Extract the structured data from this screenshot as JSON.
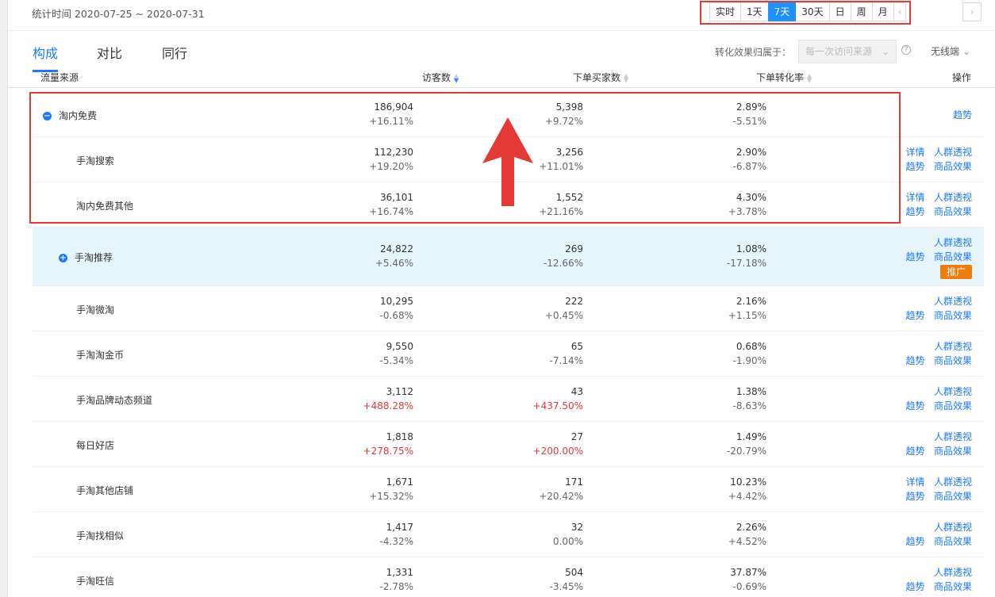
{
  "stat_time": "统计时间 2020-07-25 ~ 2020-07-31",
  "ranges": [
    "实时",
    "1天",
    "7天",
    "30天",
    "日",
    "周",
    "月"
  ],
  "prev_icon": "‹",
  "next_icon": "›",
  "tabs": [
    "构成",
    "对比",
    "同行"
  ],
  "attr_label": "转化效果归属于：",
  "attr_placeholder": "每一次访问来源",
  "help_icon": "?",
  "device": "无线端",
  "chev": "⌄",
  "columns": {
    "source": "流量来源",
    "visitors": "访客数",
    "buyers": "下单买家数",
    "rate": "下单转化率",
    "ops": "操作"
  },
  "ops_labels": {
    "detail": "详情",
    "crowd": "人群透视",
    "trend": "趋势",
    "goods": "商品效果",
    "promote": "推广"
  },
  "rows": [
    {
      "name": "淘内免费",
      "v1": "186,904",
      "c1": "+16.11%",
      "v2": "5,398",
      "c2": "+9.72%",
      "v3": "2.89%",
      "c3": "-5.51%"
    },
    {
      "name": "手淘搜索",
      "v1": "112,230",
      "c1": "+19.20%",
      "v2": "3,256",
      "c2": "+11.01%",
      "v3": "2.90%",
      "c3": "-6.87%"
    },
    {
      "name": "淘内免费其他",
      "v1": "36,101",
      "c1": "+16.74%",
      "v2": "1,552",
      "c2": "+21.16%",
      "v3": "4.30%",
      "c3": "+3.78%"
    },
    {
      "name": "手淘推荐",
      "v1": "24,822",
      "c1": "+5.46%",
      "v2": "269",
      "c2": "-12.66%",
      "v3": "1.08%",
      "c3": "-17.18%"
    },
    {
      "name": "手淘微淘",
      "v1": "10,295",
      "c1": "-0.68%",
      "v2": "222",
      "c2": "+0.45%",
      "v3": "2.16%",
      "c3": "+1.15%"
    },
    {
      "name": "手淘淘金币",
      "v1": "9,550",
      "c1": "-5.34%",
      "v2": "65",
      "c2": "-7.14%",
      "v3": "0.68%",
      "c3": "-1.90%"
    },
    {
      "name": "手淘品牌动态频道",
      "v1": "3,112",
      "c1": "+488.28%",
      "v2": "43",
      "c2": "+437.50%",
      "v3": "1.38%",
      "c3": "-8.63%"
    },
    {
      "name": "每日好店",
      "v1": "1,818",
      "c1": "+278.75%",
      "v2": "27",
      "c2": "+200.00%",
      "v3": "1.49%",
      "c3": "-20.79%"
    },
    {
      "name": "手淘其他店铺",
      "v1": "1,671",
      "c1": "+15.32%",
      "v2": "171",
      "c2": "+20.42%",
      "v3": "10.23%",
      "c3": "+4.42%"
    },
    {
      "name": "手淘找相似",
      "v1": "1,417",
      "c1": "-4.32%",
      "v2": "32",
      "c2": "0.00%",
      "v3": "2.26%",
      "c3": "+4.52%"
    },
    {
      "name": "手淘旺信",
      "v1": "1,331",
      "c1": "-2.78%",
      "v2": "504",
      "c2": "-3.45%",
      "v3": "37.87%",
      "c3": "-0.69%"
    }
  ],
  "colors": {
    "accent": "#1e78ff",
    "highlight_row": "#e6f4fb",
    "annotation": "#e53935",
    "promote": "#f07c0c",
    "increase_red": "#e4393c"
  }
}
